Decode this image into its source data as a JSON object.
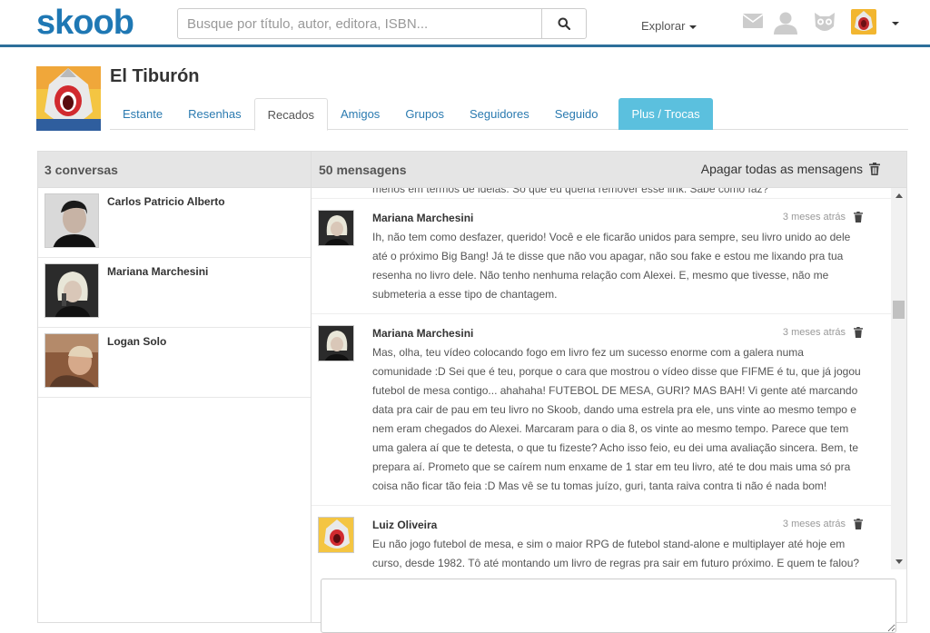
{
  "topbar": {
    "logo": "skoob",
    "search_placeholder": "Busque por título, autor, editora, ISBN...",
    "explore_label": "Explorar",
    "icons": [
      "envelope-icon",
      "user-icon",
      "owl-icon",
      "search-icon"
    ]
  },
  "profile": {
    "name": "El Tiburón",
    "tabs": [
      {
        "label": "Estante"
      },
      {
        "label": "Resenhas"
      },
      {
        "label": "Recados"
      },
      {
        "label": "Amigos"
      },
      {
        "label": "Grupos"
      },
      {
        "label": "Seguidores"
      },
      {
        "label": "Seguido"
      },
      {
        "label": "Plus / Trocas"
      }
    ],
    "active_tab": "Recados"
  },
  "conversations": {
    "header": "3 conversas",
    "items": [
      {
        "name": "Carlos Patricio Alberto"
      },
      {
        "name": "Mariana Marchesini"
      },
      {
        "name": "Logan Solo"
      }
    ]
  },
  "messages": {
    "header": "50 mensagens",
    "delete_all": "Apagar todas as mensagens",
    "partial_top": "menos em termos de ideias. Só que eu queria remover esse link. Sabe como faz?",
    "items": [
      {
        "author": "Mariana Marchesini",
        "time": "3 meses atrás",
        "text": "Ih, não tem como desfazer, querido! Você e ele ficarão unidos para sempre, seu livro unido ao dele até o próximo Big Bang! Já te disse que não vou apagar, não sou fake e estou me lixando pra tua resenha no livro dele. Não tenho nenhuma relação com Alexei. E, mesmo que tivesse, não me submeteria a esse tipo de chantagem."
      },
      {
        "author": "Mariana Marchesini",
        "time": "3 meses atrás",
        "text": "Mas, olha, teu vídeo colocando fogo em livro fez um sucesso enorme com a galera numa comunidade :D Sei que é teu, porque o cara que mostrou o vídeo disse que FIFME é tu, que já jogou futebol de mesa contigo... ahahaha! FUTEBOL DE MESA, GURI? MAS BAH! Vi gente até marcando data pra cair de pau em teu livro no Skoob, dando uma estrela pra ele, uns vinte ao mesmo tempo e nem eram chegados do Alexei. Marcaram para o dia 8, os vinte ao mesmo tempo. Parece que tem uma galera aí que te detesta, o que tu fizeste? Acho isso feio, eu dei uma avaliação sincera. Bem, te prepara aí. Prometo que se caírem num enxame de 1 star em teu livro, até te dou mais uma só pra coisa não ficar tão feia :D Mas vê se tu tomas juízo, guri, tanta raiva contra ti não é nada bom!"
      },
      {
        "author": "Luiz Oliveira",
        "time": "3 meses atrás",
        "text": "Eu não jogo futebol de mesa, e sim o maior RPG de futebol stand-alone e multiplayer até hoje em curso, desde 1982. Tô até montando um livro de regras pra sair em futuro próximo. E quem te falou? Jogou comigo? Seria o Marcelo, camarada dos pampas da regra Toque-Toque?"
      }
    ]
  },
  "colors": {
    "brand": "#1f78b4",
    "topbar_border": "#2d6f9a",
    "link": "#2a7ab0",
    "plus_tab": "#5bc0de",
    "panel_header": "#e5e5e5"
  }
}
